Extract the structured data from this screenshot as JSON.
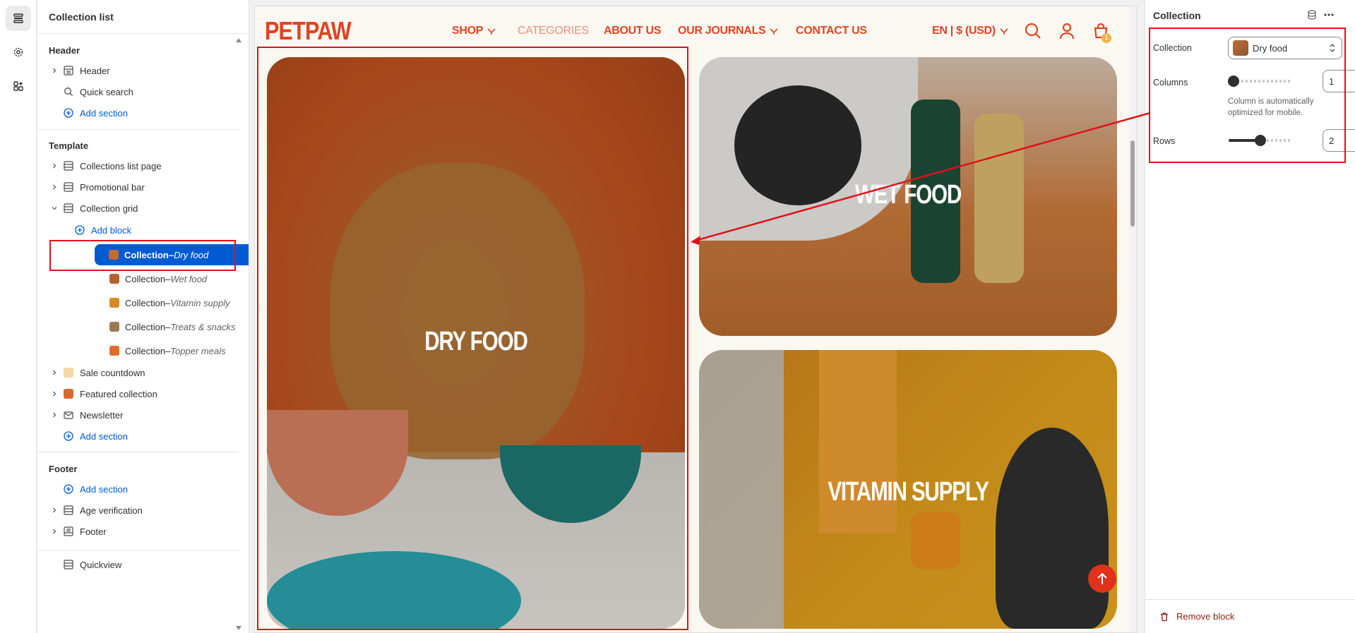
{
  "sidebar": {
    "title": "Collection list",
    "header_group": {
      "title": "Header",
      "items": [
        "Header",
        "Quick search"
      ],
      "add": "Add section"
    },
    "template_group": {
      "title": "Template",
      "items": [
        "Collections list page",
        "Promotional bar",
        "Collection grid"
      ],
      "add_block": "Add block",
      "blocks": [
        {
          "prefix": "Collection",
          "name": "Dry food",
          "thumb": "#c46a2c"
        },
        {
          "prefix": "Collection",
          "name": "Wet food",
          "thumb": "#b4622b"
        },
        {
          "prefix": "Collection",
          "name": "Vitamin supply",
          "thumb": "#d58a24"
        },
        {
          "prefix": "Collection",
          "name": "Treats & snacks",
          "thumb": "#9a7a54"
        },
        {
          "prefix": "Collection",
          "name": "Topper meals",
          "thumb": "#e06d2c"
        }
      ],
      "sections_after": [
        "Sale countdown",
        "Featured collection",
        "Newsletter"
      ],
      "add": "Add section"
    },
    "footer_group": {
      "title": "Footer",
      "add": "Add section",
      "items": [
        "Age verification",
        "Footer"
      ]
    },
    "extra": "Quickview",
    "block_separator": " – "
  },
  "store": {
    "logo": "PETPAW",
    "nav": [
      "SHOP",
      "CATEGORIES",
      "ABOUT US",
      "OUR JOURNALS",
      "CONTACT US"
    ],
    "locale": "EN | $ (USD)",
    "cart_count": "1",
    "accent": "#e04322"
  },
  "collections": [
    {
      "label": "DRY FOOD",
      "bg": "#c2531f"
    },
    {
      "label": "WET FOOD",
      "bg": "#c97a3d"
    },
    {
      "label": "VITAMIN SUPPLY",
      "bg": "#d99a1e"
    }
  ],
  "panel": {
    "title": "Collection",
    "collection_label": "Collection",
    "collection_value": "Dry food",
    "columns_label": "Columns",
    "columns_value": "1",
    "columns_help": "Column is automatically optimized for mobile.",
    "rows_label": "Rows",
    "rows_value": "2",
    "remove": "Remove block"
  }
}
